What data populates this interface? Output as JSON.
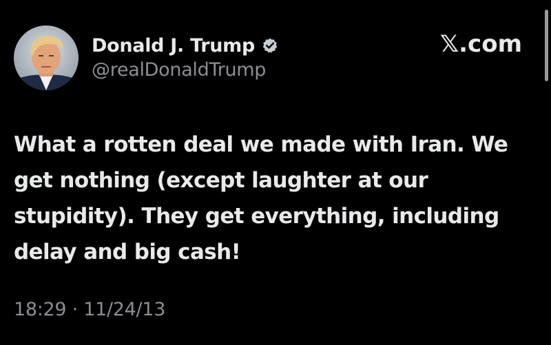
{
  "author": {
    "display_name": "Donald J. Trump",
    "handle": "@realDonaldTrump",
    "verified": true
  },
  "site": {
    "label": "𝕏.com"
  },
  "tweet": {
    "text": "What a rotten deal we made with Iran. We get nothing (except laughter at our stupidity). They get everything, including delay and big cash!",
    "time": "18:29",
    "separator": "·",
    "date": "11/24/13"
  },
  "icons": {
    "verified": "verified-badge-icon",
    "avatar": "profile-photo"
  },
  "colors": {
    "background": "#000000",
    "primary_text": "#e7e9ea",
    "secondary_text": "#8b8f94",
    "verified_badge": "#1d9bf0"
  }
}
